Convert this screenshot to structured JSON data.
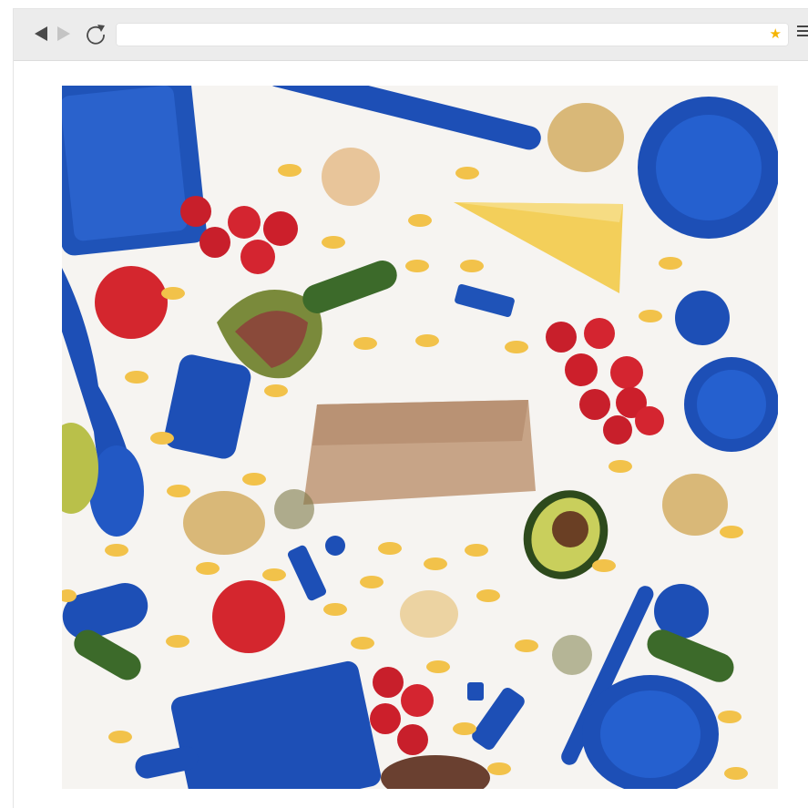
{
  "browser": {
    "url": "",
    "icons": {
      "back": "back-arrow-icon",
      "forward": "forward-arrow-icon",
      "reload": "reload-icon",
      "bookmark": "star-icon",
      "menu": "hamburger-menu-icon"
    },
    "colors": {
      "toolbar": "#ececec",
      "star": "#f5b400"
    }
  },
  "content": {
    "image_alt": ""
  }
}
